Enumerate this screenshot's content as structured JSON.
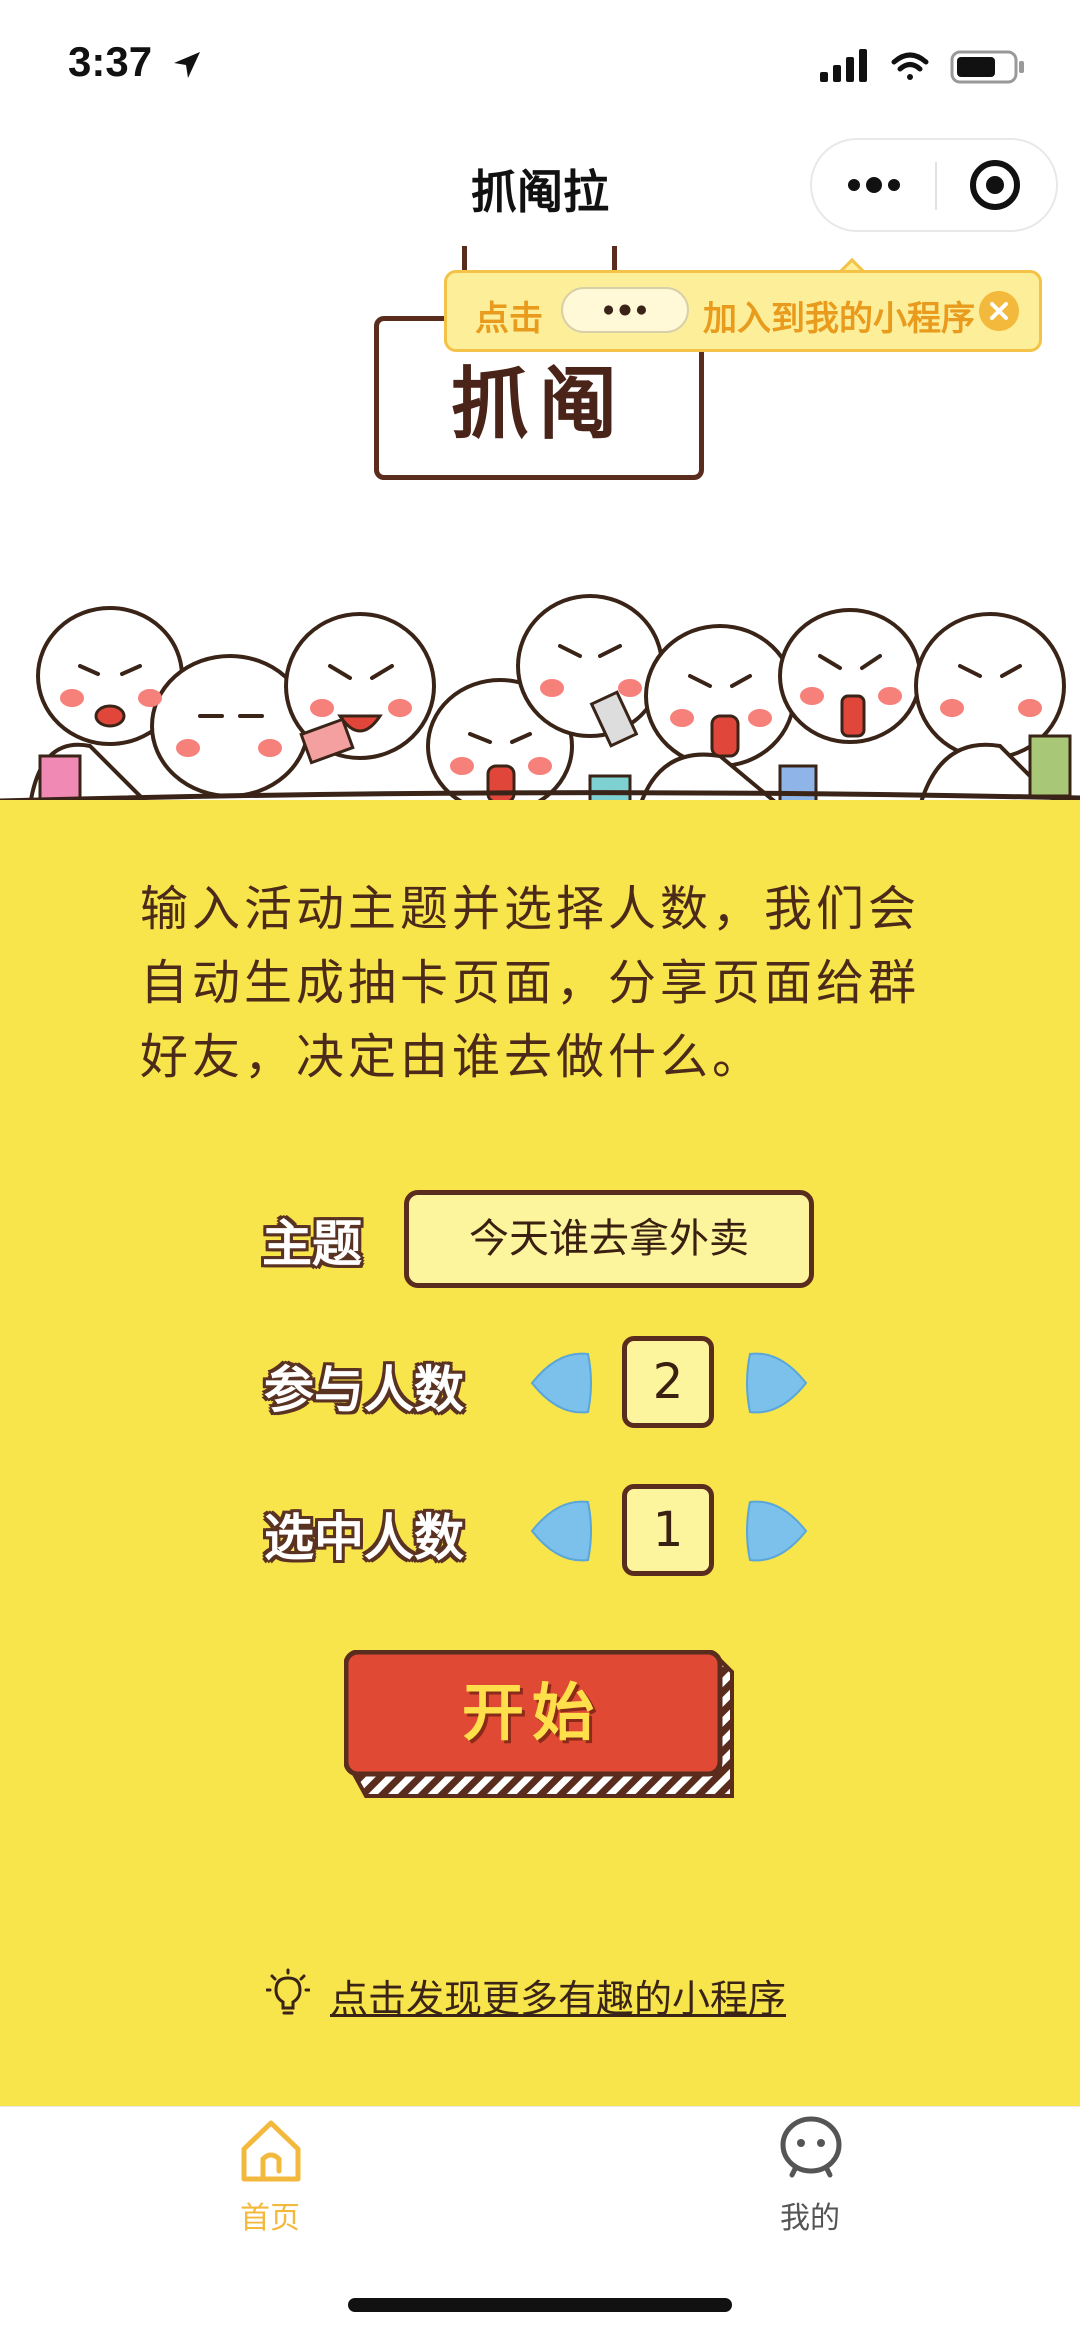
{
  "status": {
    "time": "3:37"
  },
  "nav": {
    "title": "抓阄拉"
  },
  "sign": {
    "text": "抓阄"
  },
  "tip": {
    "prefix": "点击",
    "suffix": "加入到我的小程序"
  },
  "intro": "输入活动主题并选择人数，我们会自动生成抽卡页面，分享页面给群好友，决定由谁去做什么。",
  "form": {
    "topic_label": "主题",
    "topic_value": "今天谁去拿外卖",
    "participants_label": "参与人数",
    "participants_value": "2",
    "selected_label": "选中人数",
    "selected_value": "1"
  },
  "start_button": "开始",
  "discover_link": "点击发现更多有趣的小程序",
  "tabs": [
    {
      "label": "首页",
      "active": true
    },
    {
      "label": "我的",
      "active": false
    }
  ],
  "colors": {
    "main_bg": "#f8e44b",
    "accent_tab": "#f3b93c",
    "start_button": "#e04a34",
    "arrow_button": "#7cc0ec"
  }
}
